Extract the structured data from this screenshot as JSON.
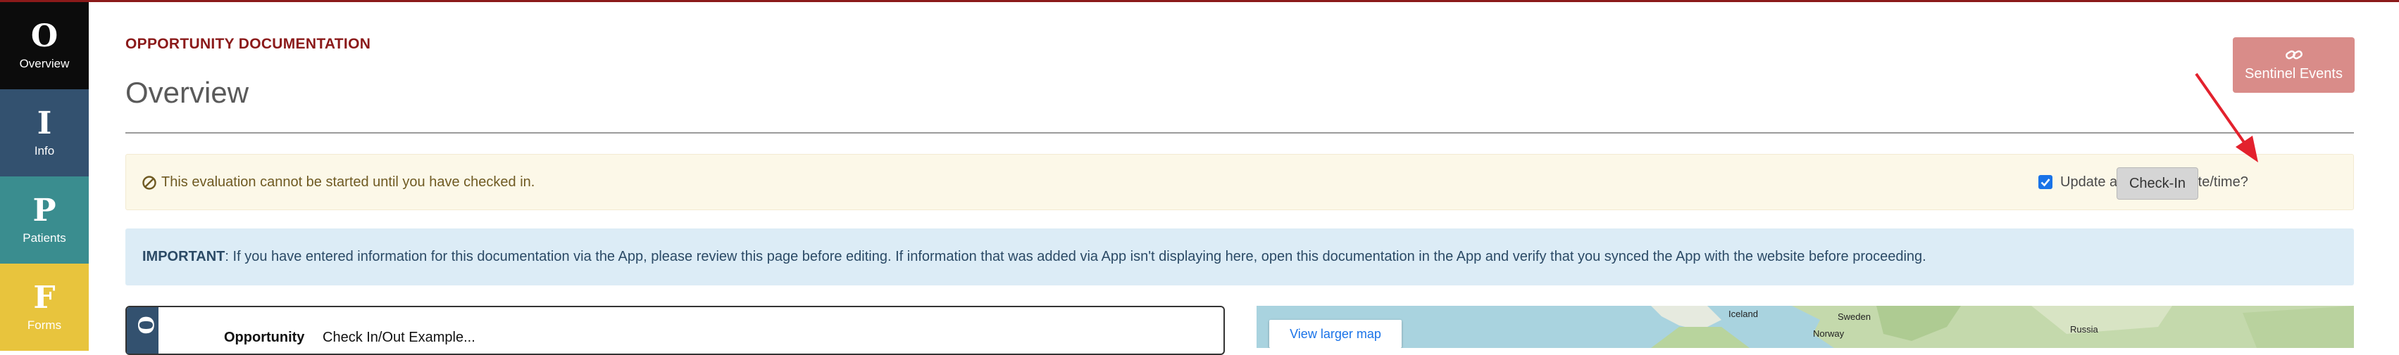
{
  "nav": [
    {
      "letter": "O",
      "label": "Overview",
      "active": true
    },
    {
      "letter": "I",
      "label": "Info"
    },
    {
      "letter": "P",
      "label": "Patients"
    },
    {
      "letter": "F",
      "label": "Forms"
    }
  ],
  "header": {
    "eyebrow": "OPPORTUNITY DOCUMENTATION",
    "title": "Overview",
    "sentinel_label": "Sentinel Events"
  },
  "warning": {
    "icon": "ban-icon",
    "text": "This evaluation cannot be started until you have checked in.",
    "checkbox_label": "Update actual start date/time?",
    "checkbox_checked": true,
    "checkin_label": "Check-In"
  },
  "important": {
    "prefix": "IMPORTANT",
    "text": ": If you have entered information for this documentation via the App, please review this page before editing. If information that was added via App isn't displaying here, open this documentation in the App and verify that you synced the App with the website before proceeding."
  },
  "card": {
    "side_letter": "O",
    "label": "Opportunity",
    "value": "Check In/Out Example..."
  },
  "map": {
    "button_label": "View larger map",
    "labels": {
      "iceland": "Iceland",
      "sweden": "Sweden",
      "norway": "Norway",
      "russia": "Russia"
    }
  },
  "colors": {
    "accent": "#8b1a1a",
    "nav_overview": "#0c0c0c",
    "nav_info": "#33516f",
    "nav_patients": "#3a8d8f",
    "nav_forms": "#e8c43d",
    "annotation_arrow": "#e3212d"
  }
}
